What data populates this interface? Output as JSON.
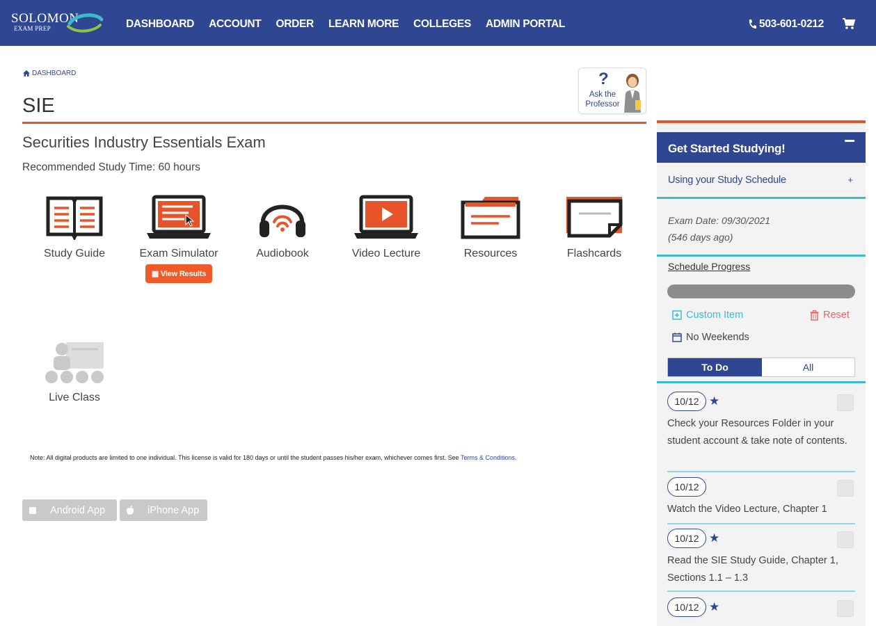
{
  "nav": {
    "logo_line1": "SOLOMON",
    "logo_line2": "EXAM PREP",
    "links": [
      "DASHBOARD",
      "ACCOUNT",
      "ORDER",
      "LEARN MORE",
      "COLLEGES",
      "ADMIN PORTAL"
    ],
    "phone": "503-601-0212",
    "cart_icon": "shopping-cart-icon",
    "bg_color": "#2f4793"
  },
  "breadcrumb": {
    "label": "DASHBOARD",
    "icon": "home-icon"
  },
  "page": {
    "title": "SIE",
    "subtitle": "Securities Industry Essentials Exam",
    "study_time": "Recommended Study Time: 60 hours",
    "accent_color": "#e8542a"
  },
  "ask_professor": {
    "label_line1": "Ask the",
    "label_line2": "Professor",
    "q": "?"
  },
  "tiles": [
    {
      "label": "Study Guide",
      "icon": "open-book-icon"
    },
    {
      "label": "Exam Simulator",
      "icon": "laptop-icon",
      "button": "View Results"
    },
    {
      "label": "Audiobook",
      "icon": "headphones-icon"
    },
    {
      "label": "Video Lecture",
      "icon": "video-laptop-icon"
    },
    {
      "label": "Resources",
      "icon": "folder-icon"
    },
    {
      "label": "Flashcards",
      "icon": "flashcard-icon"
    },
    {
      "label": "Live Class",
      "icon": "classroom-icon",
      "disabled": true
    }
  ],
  "note": {
    "text": "Note: All digital products are limited to one individual. This license is valid for 180 days or until the student passes his/her exam, whichever comes first. See",
    "link": "Terms & Conditions."
  },
  "apps": {
    "android": "Android App",
    "iphone": "iPhone App"
  },
  "sidebar": {
    "header": "Get Started Studying!",
    "schedule_link": "Using your Study Schedule",
    "exam_date": "Exam Date: 09/30/2021",
    "days_ago": "(546 days ago)",
    "progress_label": "Schedule Progress",
    "custom_item": "Custom Item",
    "reset": "Reset",
    "no_weekends": "No Weekends",
    "tabs": {
      "todo": "To Do",
      "all": "All"
    },
    "tasks": [
      {
        "date": "10/12",
        "starred": true,
        "text": "Check your Resources Folder in your student account & take note of contents."
      },
      {
        "date": "10/12",
        "starred": false,
        "text": "Watch the Video Lecture, Chapter 1"
      },
      {
        "date": "10/12",
        "starred": true,
        "text": "Read the SIE Study Guide, Chapter 1, Sections 1.1 – 1.3"
      },
      {
        "date": "10/12",
        "starred": true,
        "text": ""
      }
    ]
  }
}
